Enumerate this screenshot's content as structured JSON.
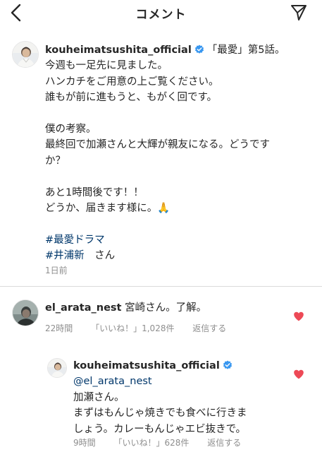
{
  "header": {
    "title": "コメント",
    "back_icon": "chevron-left-icon",
    "send_icon": "paper-plane-icon"
  },
  "colors": {
    "text": "#262626",
    "secondary": "#8e8e8e",
    "link": "#00376b",
    "verified": "#3897f0",
    "like": "#ed4956",
    "divider": "#dbdbdb"
  },
  "post": {
    "username": "kouheimatsushita_official",
    "first_line": "「最愛」第5話。",
    "lines": [
      "今週も一足先に見ました。",
      "ハンカチをご用意の上ご覧ください。",
      "誰もが前に進もうと、もがく回です。",
      "",
      "僕の考察。",
      "最終回で加瀬さんと大輝が親友になる。どうです",
      "か？",
      "",
      "あと1時間後です！！",
      "どうか、届きます様に。🙏",
      ""
    ],
    "hashtag": "#最愛ドラマ",
    "mention": "#井浦新",
    "mention_suffix": "　さん",
    "time": "1日前"
  },
  "comment": {
    "username": "el_arata_nest",
    "text": "宮崎さん。了解。",
    "time": "22時間",
    "likes": "「いいね！」1,028件",
    "reply_label": "返信する"
  },
  "reply": {
    "username": "kouheimatsushita_official",
    "mention": "@el_arata_nest",
    "lines": [
      "加瀬さん。",
      "まずはもんじゃ焼きでも食べに行きま",
      "しょう。カレーもんじゃエビ抜きで。"
    ],
    "time": "9時間",
    "likes": "「いいね！」628件",
    "reply_label": "返信する"
  }
}
